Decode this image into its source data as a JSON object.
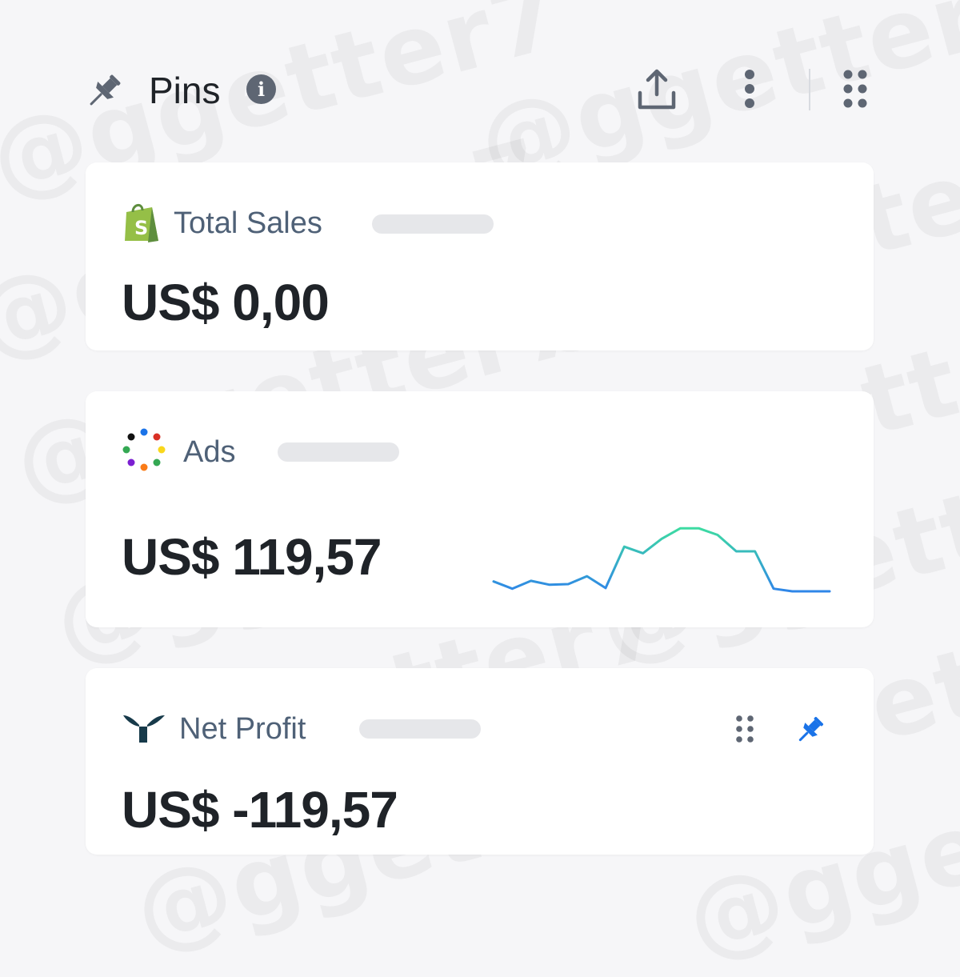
{
  "header": {
    "title": "Pins",
    "icons": {
      "pin": "pin-icon",
      "info": "info-icon",
      "info_glyph": "i",
      "share": "share-icon",
      "more": "more-vertical-icon",
      "grid": "drag-grid-icon"
    }
  },
  "watermark": "@ggetter7",
  "cards": [
    {
      "label": "Total Sales",
      "value": "US$ 0,00",
      "logo": "shopify-logo"
    },
    {
      "label": "Ads",
      "value": "US$ 119,57",
      "logo": "ads-dots-logo",
      "sparkline_relative": [
        0.15,
        0.04,
        0.16,
        0.1,
        0.11,
        0.23,
        0.05,
        0.68,
        0.58,
        0.8,
        0.96,
        0.96,
        0.86,
        0.61,
        0.61,
        0.04,
        0.0,
        0.0,
        0.0
      ]
    },
    {
      "label": "Net Profit",
      "value": "US$ -119,57",
      "logo": "triple-whale-logo",
      "icons": [
        "drag-handle-icon",
        "pin-icon"
      ]
    }
  ],
  "colors": {
    "accent_blue": "#1a73e8",
    "label": "#4f6177",
    "shopify_green": "#95bf47",
    "spark_start": "#2f86e8",
    "spark_end": "#3ddba2"
  }
}
